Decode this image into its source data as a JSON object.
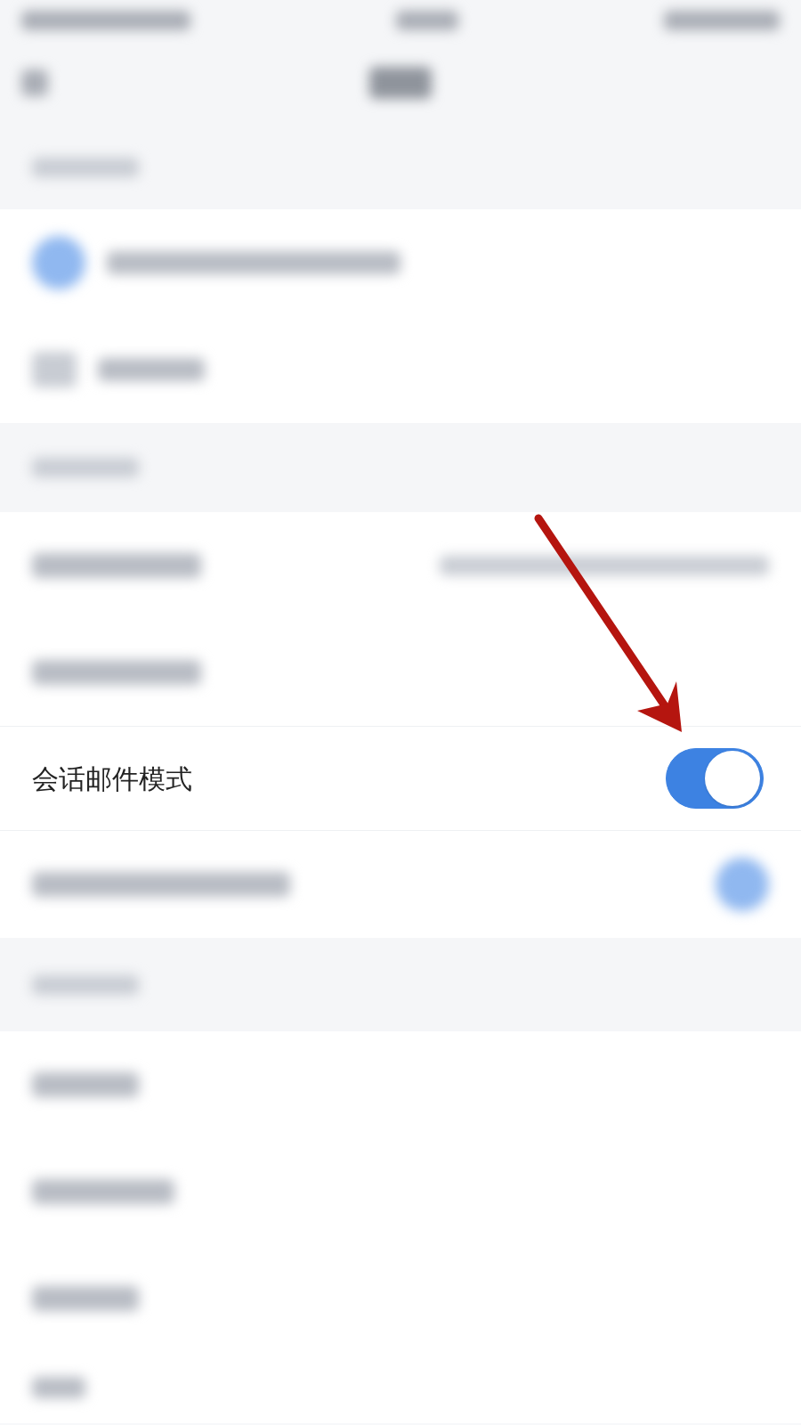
{
  "settings_row": {
    "label": "会话邮件模式",
    "kind": "toggle",
    "on": true
  }
}
